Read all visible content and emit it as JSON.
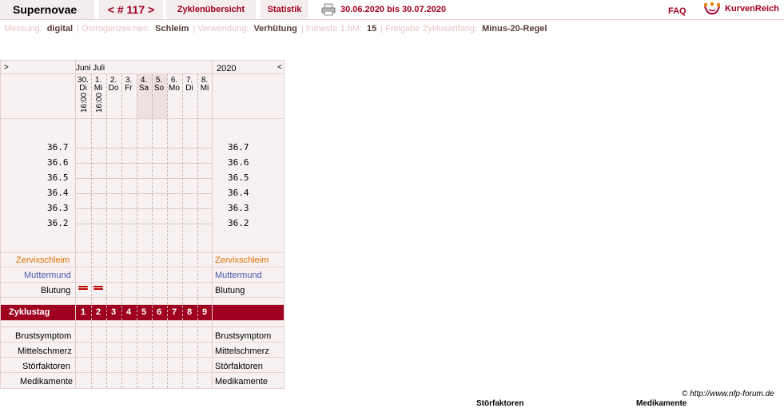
{
  "header": {
    "app_title": "Supernovae",
    "cycle_nav": "< # 117 >",
    "tab_overview": "Zyklenübersicht",
    "tab_stats": "Statistik",
    "date_range": "30.06.2020 bis 30.07.2020",
    "faq": "FAQ",
    "brand": "KurvenReich",
    "icons": [
      "printer-icon",
      "kurvenreich-logo-icon"
    ]
  },
  "settings": {
    "messung_label": "Messung:",
    "messung": "digital",
    "oestrogen_label": "Östrogenzeichen:",
    "oestrogen": "Schleim",
    "verwendung_label": "Verwendung:",
    "verwendung": "Verhütung",
    "hm_label": "früheste 1.hM:",
    "hm": "15",
    "freigabe_label": "Freigabe Zyklusanfang:",
    "freigabe": "Minus-20-Regel",
    "separator": "|"
  },
  "chart": {
    "nav_prev": ">",
    "nav_next": "<",
    "months": "Juni Juli",
    "year": "2020",
    "days": [
      {
        "date": "30.",
        "weekday": "Di",
        "time": "16:00"
      },
      {
        "date": "1.",
        "weekday": "Mi",
        "time": "16:00"
      },
      {
        "date": "2.",
        "weekday": "Do",
        "time": ""
      },
      {
        "date": "3.",
        "weekday": "Fr",
        "time": ""
      },
      {
        "date": "4.",
        "weekday": "Sa",
        "time": ""
      },
      {
        "date": "5.",
        "weekday": "So",
        "time": ""
      },
      {
        "date": "6.",
        "weekday": "Mo",
        "time": ""
      },
      {
        "date": "7.",
        "weekday": "Di",
        "time": ""
      },
      {
        "date": "8.",
        "weekday": "Mi",
        "time": ""
      }
    ],
    "temperatures": [
      "36.7",
      "36.6",
      "36.5",
      "36.4",
      "36.3",
      "36.2"
    ],
    "rows": {
      "zervixschleim": "Zervixschleim",
      "muttermund": "Muttermund",
      "blutung": "Blutung",
      "zyklustag": "Zyklustag",
      "brustsymptom": "Brustsymptom",
      "mittelschmerz": "Mittelschmerz",
      "stoerfaktoren": "Störfaktoren",
      "medikamente": "Medikamente"
    },
    "cycle_days": [
      "1",
      "2",
      "3",
      "4",
      "5",
      "6",
      "7",
      "8",
      "9"
    ],
    "colors": {
      "accent": "#a00020",
      "zervix": "#e07000",
      "muttermund": "#4a5ab0",
      "bleeding": "#c00000"
    }
  },
  "footer": {
    "copyright": "© http://www.nfp-forum.de",
    "cut_labels": [
      "Störfaktoren",
      "Medikamente"
    ]
  }
}
